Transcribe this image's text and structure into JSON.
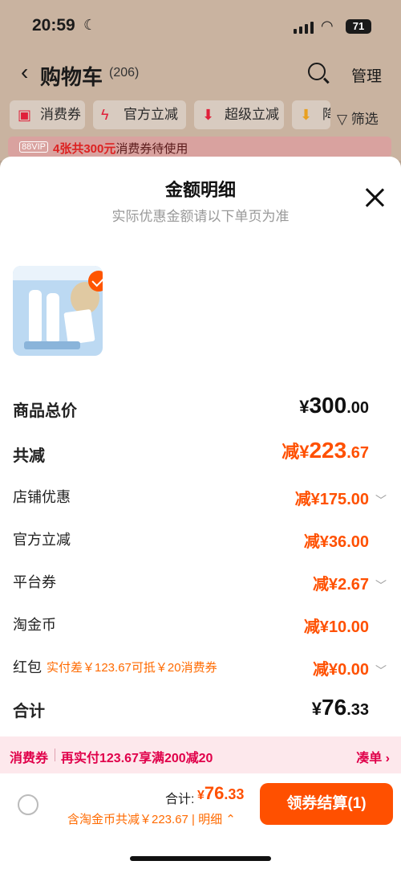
{
  "status_bar": {
    "time": "20:59",
    "battery": "71"
  },
  "header": {
    "title": "购物车",
    "count": "(206)",
    "manage": "管理"
  },
  "filters": [
    {
      "label": "消费券",
      "icon": "coupon-icon"
    },
    {
      "label": "官方立减",
      "icon": "lightning-icon"
    },
    {
      "label": "超级立减",
      "icon": "arrow-down-icon"
    },
    {
      "label": "降",
      "icon": "arrow-down-icon"
    }
  ],
  "filter_button": "筛选",
  "vip_banner": {
    "badge": "88VIP",
    "highlight": "4张共300元",
    "text": "消费券待使用"
  },
  "sheet": {
    "title": "金额明细",
    "subtitle": "实际优惠金额请以下单页为准"
  },
  "rows": {
    "total_price": {
      "label": "商品总价",
      "yen": "¥",
      "int": "300",
      "dec": ".00"
    },
    "total_reduce": {
      "label": "共减",
      "prefix": "减¥",
      "int": "223",
      "dec": ".67"
    },
    "shop": {
      "label": "店铺优惠",
      "prefix": "减¥",
      "int": "175",
      "dec": ".00"
    },
    "official": {
      "label": "官方立减",
      "prefix": "减¥",
      "int": "36",
      "dec": ".00"
    },
    "platform": {
      "label": "平台券",
      "prefix": "减¥",
      "int": "2",
      "dec": ".67"
    },
    "taojinbi": {
      "label": "淘金币",
      "prefix": "减¥",
      "int": "10",
      "dec": ".00"
    },
    "redpacket": {
      "label": "红包",
      "note": "实付差￥123.67可抵￥20消费券",
      "prefix": "减¥",
      "int": "0",
      "dec": ".00"
    },
    "sum": {
      "label": "合计",
      "yen": "¥",
      "int": "76",
      "dec": ".33"
    }
  },
  "promo": {
    "tag": "消费券",
    "text": "再实付123.67享满200减20",
    "action": "凑单 ›"
  },
  "bottom": {
    "total_label": "合计:",
    "total_yen": "¥",
    "total_int": "76",
    "total_dec": ".33",
    "sub": "含淘金币共减￥223.67 | 明细 ⌃",
    "checkout": "领券结算(1)"
  },
  "colors": {
    "accent": "#ff5000",
    "promo_text": "#e0004a"
  }
}
